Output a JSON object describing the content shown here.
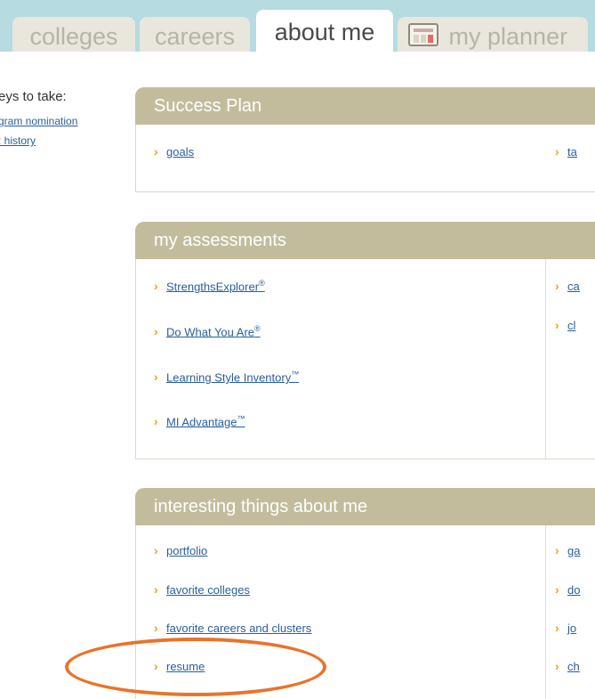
{
  "tabs": [
    {
      "label": "colleges"
    },
    {
      "label": "careers"
    },
    {
      "label": "about me"
    },
    {
      "label": "my planner"
    }
  ],
  "left": {
    "title": "eys to take:",
    "links": [
      "gram nomination",
      ": history"
    ]
  },
  "success_plan": {
    "header": "Success Plan",
    "left_items": [
      "goals"
    ],
    "right_items": [
      "ta"
    ]
  },
  "assessments": {
    "header": "my assessments",
    "left_items": [
      {
        "text": "StrengthsExplorer",
        "mark": "®"
      },
      {
        "text": "Do What You Are",
        "mark": "®"
      },
      {
        "text": "Learning Style Inventory",
        "mark": "™"
      },
      {
        "text": "MI Advantage",
        "mark": "™"
      }
    ],
    "right_items": [
      "ca",
      "cl"
    ]
  },
  "interesting": {
    "header": "interesting things about me",
    "left_items": [
      "portfolio",
      "favorite colleges",
      "favorite careers and clusters",
      "resume"
    ],
    "right_items": [
      "ga",
      "do",
      "jo",
      "ch"
    ]
  },
  "colors": {
    "tabbar_bg": "#b6dbe0",
    "section_header_bg": "#c3bc9c",
    "link": "#2a5f9e",
    "chevron": "#f2a11c",
    "highlight": "#e8742a"
  }
}
